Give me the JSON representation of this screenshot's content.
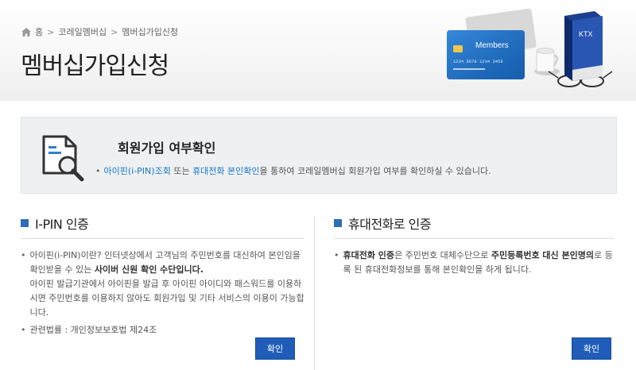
{
  "breadcrumb": {
    "home": "홈",
    "level1": "코레일멤버십",
    "level2": "멤버십가입신청"
  },
  "page_title": "멤버십가입신청",
  "illustration": {
    "card_label": "Members",
    "card_number": "1234 5678 1234 3456",
    "book_label": "KTX"
  },
  "confirm": {
    "title": "회원가입 여부확인",
    "desc_link1": "아이핀(i-PIN)조회",
    "desc_mid": " 또는 ",
    "desc_link2": "휴대전화 본인확인",
    "desc_tail": "을 통하여 코레일멤버십 회원가입 여부를 확인하실 수 있습니다."
  },
  "ipin": {
    "title": "I-PIN 인증",
    "p1_a": "아이핀(i-PIN)이란? 인터넷상에서 고객님의 주민번호를 대신하여 본인임을 확인받을 수 있는 ",
    "p1_strong": "사이버 신원 확인 수단입니다.",
    "p1_b": "아이핀 발급기관에서 아이핀을 발급 후 아이핀 아이디와 패스워드를 이용하시면 주민번호를 이용하지 않아도 회원가입 및 기타 서비스의 이용이 가능합니다.",
    "p2": "관련법률 : 개인정보보호법 제24조",
    "button": "확인"
  },
  "phone": {
    "title": "휴대전화로 인증",
    "p_strong1": "휴대전화 인증",
    "p_a": "은 주민번호 대체수단으로 ",
    "p_strong2": "주민등록번호 대신 본인명의",
    "p_b": "로 등록 된 휴대전화정보를 통해 본인확인을 하게 됩니다.",
    "button": "확인"
  },
  "colors": {
    "accent": "#1f5db8",
    "link": "#1a78c2"
  }
}
